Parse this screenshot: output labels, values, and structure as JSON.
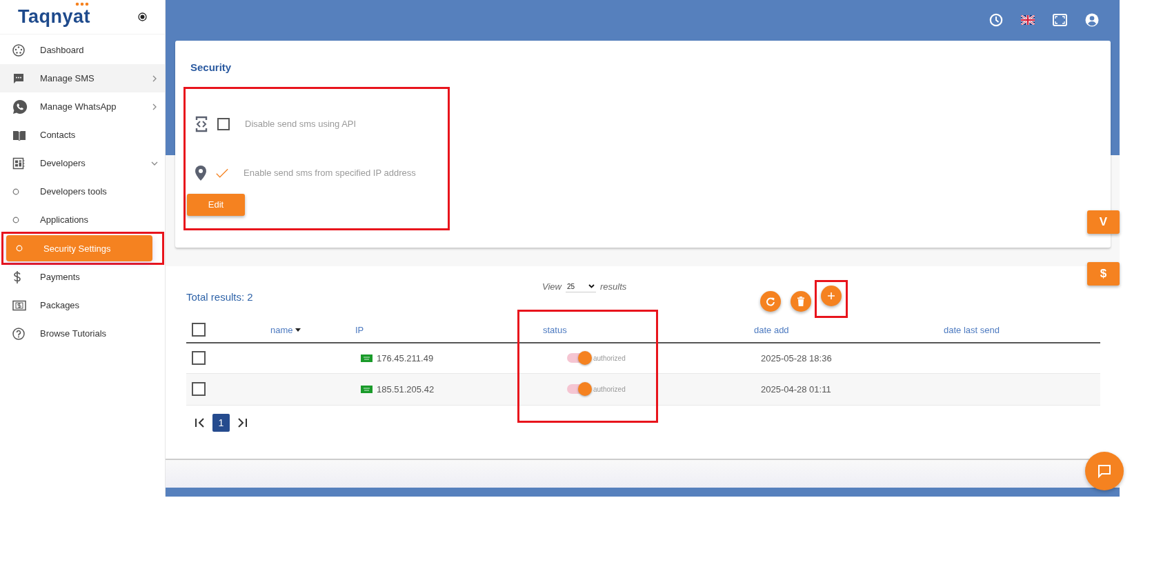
{
  "brand": {
    "name": "Taqnyat"
  },
  "sidebar": {
    "items": [
      {
        "label": "Dashboard",
        "selected": false,
        "hovered": false
      },
      {
        "label": "Manage SMS",
        "selected": false,
        "hovered": true,
        "expanded": false
      },
      {
        "label": "Manage WhatsApp",
        "selected": false,
        "hovered": false,
        "expanded": false
      },
      {
        "label": "Contacts",
        "selected": false,
        "hovered": false
      },
      {
        "label": "Developers",
        "selected": false,
        "hovered": false,
        "expanded": true,
        "children": [
          {
            "label": "Developers tools",
            "selected": false,
            "highlighted": false
          },
          {
            "label": "Applications",
            "selected": false,
            "highlighted": false
          },
          {
            "label": "Security Settings",
            "selected": true,
            "highlighted": true
          }
        ]
      },
      {
        "label": "Payments",
        "selected": false,
        "hovered": false
      },
      {
        "label": "Packages",
        "selected": false,
        "hovered": false
      },
      {
        "label": "Browse Tutorials",
        "selected": false,
        "hovered": false
      }
    ]
  },
  "security": {
    "title": "Security",
    "highlighted": true,
    "options": [
      {
        "label": "Disable send sms using API",
        "checked": false
      },
      {
        "label": "Enable send sms from specified IP address",
        "checked": true
      }
    ],
    "edit_button": "Edit"
  },
  "side_buttons": [
    "V",
    "$"
  ],
  "list": {
    "total": "Total results: 2",
    "view_label": "View",
    "page_size": "25",
    "results_label": "results",
    "all_checked": false,
    "actions": [
      {
        "highlighted": false
      },
      {
        "highlighted": false
      },
      {
        "highlighted": true
      }
    ],
    "columns": [
      {
        "label": "name",
        "sortable": true,
        "highlighted": false
      },
      {
        "label": "IP",
        "sortable": false,
        "highlighted": false
      },
      {
        "label": "status",
        "sortable": false,
        "highlighted": true
      },
      {
        "label": "date add",
        "sortable": false,
        "highlighted": false
      },
      {
        "label": "date last send",
        "sortable": false,
        "highlighted": false
      }
    ],
    "rows": [
      {
        "checked": false,
        "ip": "176.45.211.49",
        "status": "authorized",
        "on": true,
        "date_add": "2025-05-28 18:36"
      },
      {
        "checked": false,
        "ip": "185.51.205.42",
        "status": "authorized",
        "on": true,
        "date_add": "2025-04-28 01:11"
      }
    ],
    "pages": [
      {
        "label": "1",
        "selected": true
      }
    ]
  }
}
